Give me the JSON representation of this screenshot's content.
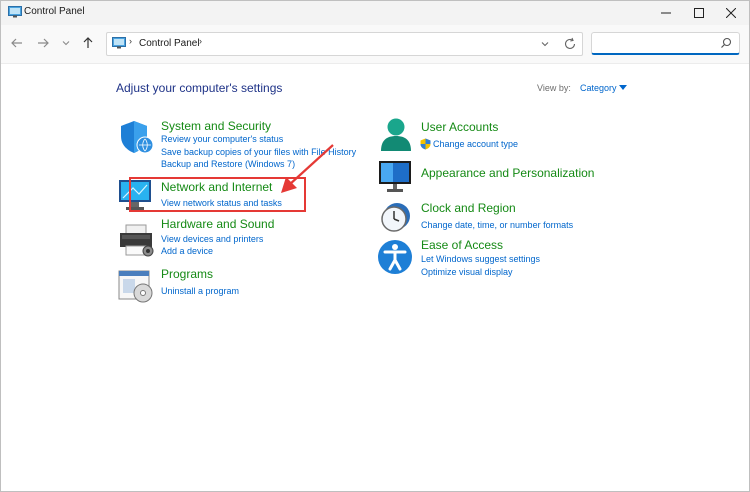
{
  "window": {
    "title": "Control Panel"
  },
  "address_bar": {
    "separator": "›",
    "location": "Control Panel"
  },
  "search": {
    "placeholder": ""
  },
  "main": {
    "heading": "Adjust your computer's settings",
    "view_by_label": "View by:",
    "view_by_value": "Category"
  },
  "categories": [
    {
      "title": "System and Security",
      "links": [
        "Review your computer's status",
        "Save backup copies of your files with File History",
        "Backup and Restore (Windows 7)"
      ]
    },
    {
      "title": "Network and Internet",
      "links": [
        "View network status and tasks"
      ]
    },
    {
      "title": "Hardware and Sound",
      "links": [
        "View devices and printers",
        "Add a device"
      ]
    },
    {
      "title": "Programs",
      "links": [
        "Uninstall a program"
      ]
    },
    {
      "title": "User Accounts",
      "links": [
        "Change account type"
      ]
    },
    {
      "title": "Appearance and Personalization",
      "links": []
    },
    {
      "title": "Clock and Region",
      "links": [
        "Change date, time, or number formats"
      ]
    },
    {
      "title": "Ease of Access",
      "links": [
        "Let Windows suggest settings",
        "Optimize visual display"
      ]
    }
  ],
  "icons": [
    "control-panel-icon",
    "minimize-icon",
    "maximize-icon",
    "close-icon",
    "back-arrow-icon",
    "forward-arrow-icon",
    "recent-chevron-icon",
    "up-arrow-icon",
    "search-icon",
    "refresh-icon",
    "shield-icon",
    "network-monitor-icon",
    "printer-icon",
    "programs-icon",
    "user-icon",
    "appearance-icon",
    "clock-icon",
    "ease-of-access-icon",
    "uac-shield-icon"
  ],
  "colors": {
    "category_title": "#158a15",
    "link": "#0066cc",
    "heading": "#1e3287",
    "annotation": "#e53935"
  }
}
